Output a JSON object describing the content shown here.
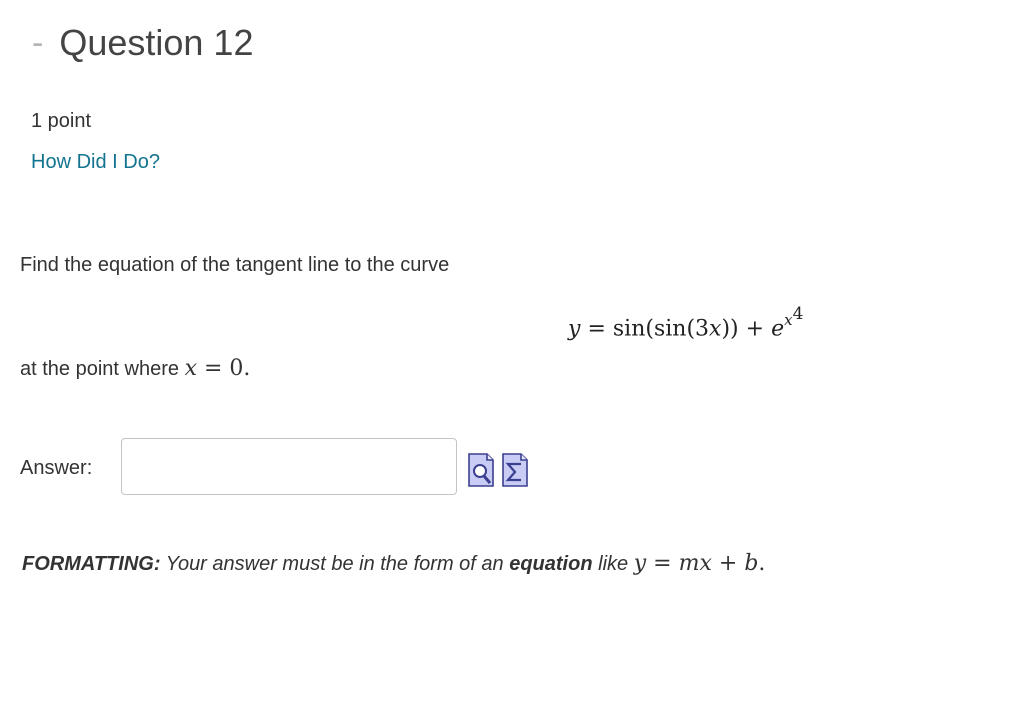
{
  "header": {
    "toggle_symbol": "-",
    "title": "Question 12"
  },
  "points": "1 point",
  "feedback_link": "How Did I Do?",
  "prompt": {
    "intro": "Find the equation of the tangent line to the curve",
    "equation": {
      "lhs": "y",
      "equals": "=",
      "fn": "sin(sin(3",
      "var": "x",
      "close": "))",
      "plus": "+",
      "base": "e",
      "exp_var": "x",
      "exp_power": "4"
    },
    "point_text": "at the point where",
    "point_var": "x",
    "point_equals": "=",
    "point_value": "0",
    "point_period": "."
  },
  "answer": {
    "label": "Answer:",
    "value": "",
    "placeholder": ""
  },
  "tools": [
    {
      "name": "preview",
      "icon": "preview-magnifier-icon"
    },
    {
      "name": "equation",
      "icon": "equation-sigma-icon"
    }
  ],
  "formatting": {
    "label": "FORMATTING:",
    "text_before": "Your answer must be in the form of an",
    "emphasis": "equation",
    "text_after": "like",
    "example_y": "y",
    "example_eq": "=",
    "example_m": "m",
    "example_x": "x",
    "example_plus": "+",
    "example_b": "b",
    "period": "."
  },
  "colors": {
    "link": "#13748f",
    "toggle": "#b3b3b3",
    "input_border": "#c4c4c4",
    "icon_fill": "#c9cdf5",
    "icon_stroke": "#3a3f8f"
  }
}
